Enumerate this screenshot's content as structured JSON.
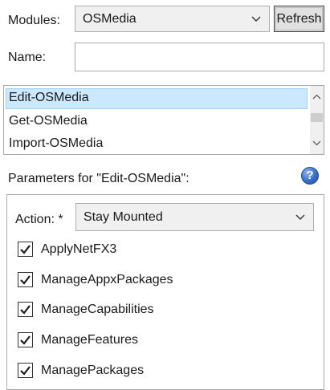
{
  "modules": {
    "label": "Modules:",
    "selected": "OSMedia",
    "refresh_label": "Refresh"
  },
  "name": {
    "label": "Name:",
    "value": ""
  },
  "commands": {
    "items": [
      {
        "label": "Edit-OSMedia",
        "selected": true
      },
      {
        "label": "Get-OSMedia",
        "selected": false
      },
      {
        "label": "Import-OSMedia",
        "selected": false
      }
    ]
  },
  "parameters": {
    "title": "Parameters for \"Edit-OSMedia\":",
    "help_glyph": "?",
    "help_icon": "help-icon",
    "action": {
      "label": "Action: *",
      "selected": "Stay Mounted"
    },
    "switches": [
      {
        "label": "ApplyNetFX3",
        "checked": true
      },
      {
        "label": "ManageAppxPackages",
        "checked": true
      },
      {
        "label": "ManageCapabilities",
        "checked": true
      },
      {
        "label": "ManageFeatures",
        "checked": true
      },
      {
        "label": "ManagePackages",
        "checked": true
      }
    ]
  },
  "colors": {
    "selection_bg": "#cce8ff",
    "selection_border": "#99d1ff",
    "help_blue": "#3a6fc5"
  }
}
